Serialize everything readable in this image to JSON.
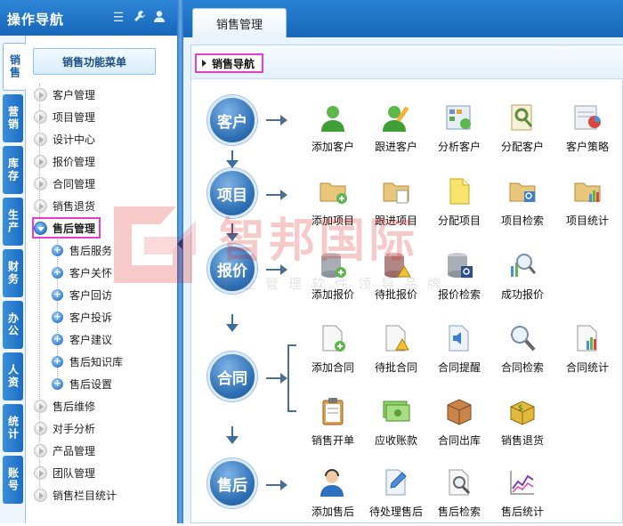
{
  "nav": {
    "title": "操作导航",
    "header_icons": [
      "list-icon",
      "wrench-icon",
      "user-icon"
    ]
  },
  "vertical_tabs": [
    "销售",
    "营销",
    "库存",
    "生产",
    "财务",
    "办公",
    "人资",
    "统计",
    "账号"
  ],
  "menu": {
    "title": "销售功能菜单",
    "items": [
      "客户管理",
      "项目管理",
      "设计中心",
      "报价管理",
      "合同管理",
      "销售退货",
      "售后管理",
      "售后维修",
      "对手分析",
      "产品管理",
      "团队管理",
      "销售栏目统计"
    ],
    "open_item": "售后管理",
    "sub_items": [
      "售后服务",
      "客户关怀",
      "客户回访",
      "客户投诉",
      "客户建议",
      "售后知识库",
      "售后设置"
    ]
  },
  "tab": {
    "label": "销售管理"
  },
  "breadcrumb": "销售导航",
  "flow": [
    {
      "stage": "客户",
      "items": [
        "添加客户",
        "跟进客户",
        "分析客户",
        "分配客户",
        "客户策略"
      ]
    },
    {
      "stage": "项目",
      "items": [
        "添加项目",
        "跟进项目",
        "分配项目",
        "项目检索",
        "项目统计"
      ]
    },
    {
      "stage": "报价",
      "items": [
        "添加报价",
        "待批报价",
        "报价检索",
        "成功报价"
      ]
    },
    {
      "stage": "合同",
      "items": [
        "添加合同",
        "待批合同",
        "合同提醒",
        "合同检索",
        "合同统计",
        "销售开单",
        "应收账款",
        "合同出库",
        "销售退货"
      ]
    },
    {
      "stage": "售后",
      "items": [
        "添加售后",
        "待处理售后",
        "售后检索",
        "售后统计"
      ]
    }
  ],
  "watermark": {
    "text": "智邦国际",
    "sub": "企业管理软件领导品牌"
  },
  "colors": {
    "header_blue": "#1767b8",
    "highlight": "#e040d0",
    "stage_blue": "#2e6fb4"
  }
}
